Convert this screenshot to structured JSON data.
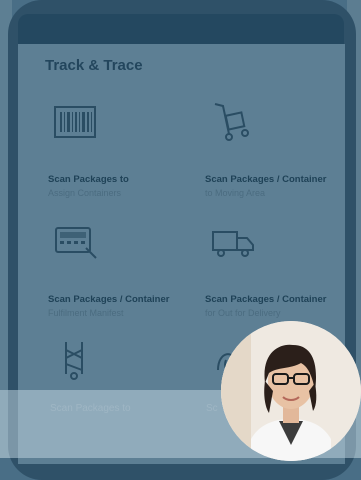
{
  "app": {
    "title": "Track & Trace"
  },
  "tiles": [
    {
      "title": "Scan Packages to",
      "subtitle": "Assign Containers",
      "icon": "barcode-icon"
    },
    {
      "title": "Scan Packages / Container",
      "subtitle": "to Moving Area",
      "icon": "hand-truck-icon"
    },
    {
      "title": "Scan Packages / Container",
      "subtitle": "Fulfilment Manifest",
      "icon": "cash-register-icon"
    },
    {
      "title": "Scan Packages / Container",
      "subtitle": "for Out for Delivery",
      "icon": "delivery-truck-icon"
    }
  ],
  "bottom_row": {
    "left_label": "Scan Packages to",
    "right_label": "Sc",
    "left_icon": "dolly-icon",
    "right_icon": "signature-icon"
  },
  "avatar": {
    "icon": "user-avatar-photo"
  },
  "colors": {
    "overlay": "#496e86",
    "title": "#23465d",
    "tile_title": "#1f4257"
  }
}
